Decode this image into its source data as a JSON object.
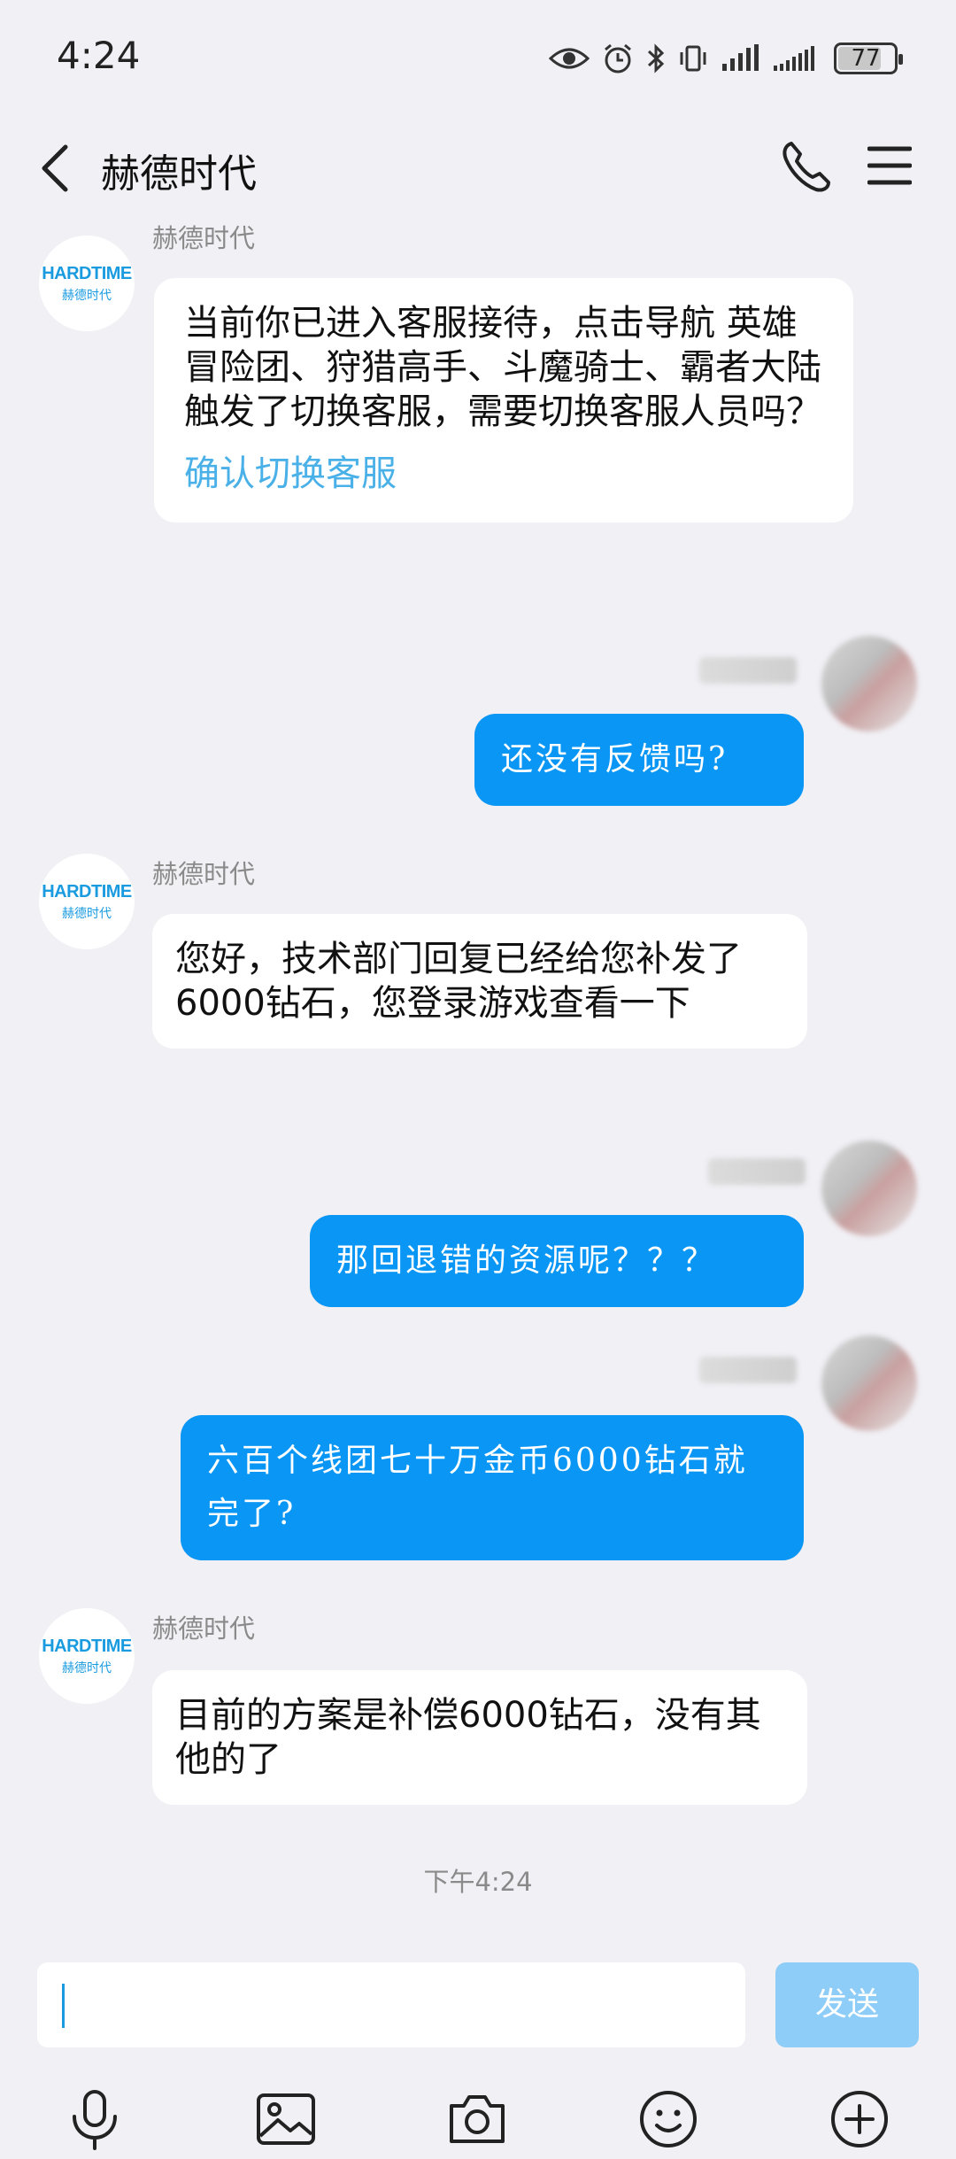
{
  "status_bar": {
    "time": "4:24",
    "battery": "77"
  },
  "header": {
    "title": "赫德时代"
  },
  "avatar_logo": {
    "main": "HARDTIME",
    "sub": "赫德时代"
  },
  "messages": [
    {
      "sender": "赫德时代",
      "text": "当前你已进入客服接待，点击导航 英雄冒险团、狩猎高手、斗魔骑士、霸者大陆 触发了切换客服，需要切换客服人员吗？",
      "link": "确认切换客服"
    },
    {
      "text": "还没有反馈吗?"
    },
    {
      "sender": "赫德时代",
      "text": "您好，技术部门回复已经给您补发了6000钻石，您登录游戏查看一下"
    },
    {
      "text": "那回退错的资源呢？？？"
    },
    {
      "text": "六百个线团七十万金币6000钻石就完了?"
    },
    {
      "sender": "赫德时代",
      "text": "目前的方案是补偿6000钻石，没有其他的了"
    }
  ],
  "timestamp": "下午4:24",
  "input": {
    "value": "",
    "send_label": "发送"
  },
  "toolbar_icons": [
    "microphone-icon",
    "image-icon",
    "camera-icon",
    "emoji-icon",
    "plus-icon"
  ],
  "colors": {
    "outgoing_bubble": "#0a96f5",
    "link": "#4ab0e8",
    "send_button": "#8dcdf7",
    "background": "#f1f0f5"
  }
}
